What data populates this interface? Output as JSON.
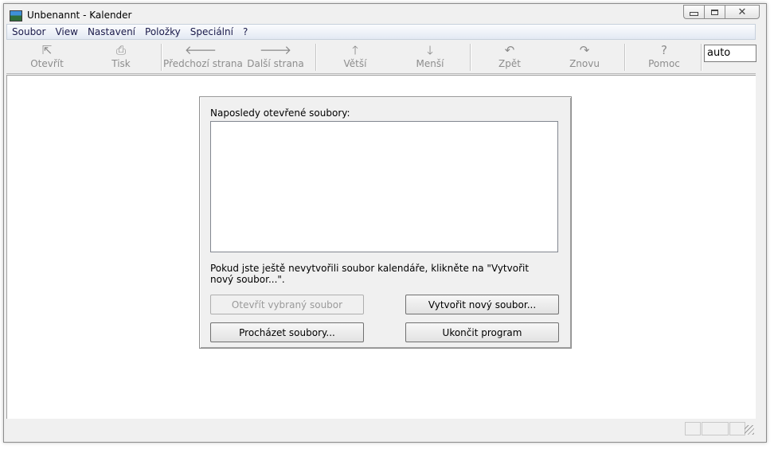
{
  "window": {
    "title": "Unbenannt - Kalender"
  },
  "menu": [
    "Soubor",
    "View",
    "Nastavení",
    "Položky",
    "Speciální",
    "?"
  ],
  "toolbar": {
    "open": "Otevřít",
    "print": "Tisk",
    "prev_page": "Předchozí strana",
    "next_page": "Další strana",
    "larger": "Větší",
    "smaller": "Menší",
    "undo": "Zpět",
    "redo": "Znovu",
    "help": "Pomoc",
    "zoom_value": "auto"
  },
  "dialog": {
    "recent_label": "Naposledy otevřené soubory:",
    "note": "Pokud jste ještě nevytvořili soubor kalendáře, klikněte na \"Vytvořit nový soubor...\".",
    "open_selected": "Otevřít vybraný soubor",
    "create_new": "Vytvořit nový soubor...",
    "browse": "Procházet soubory...",
    "exit": "Ukončit program"
  }
}
